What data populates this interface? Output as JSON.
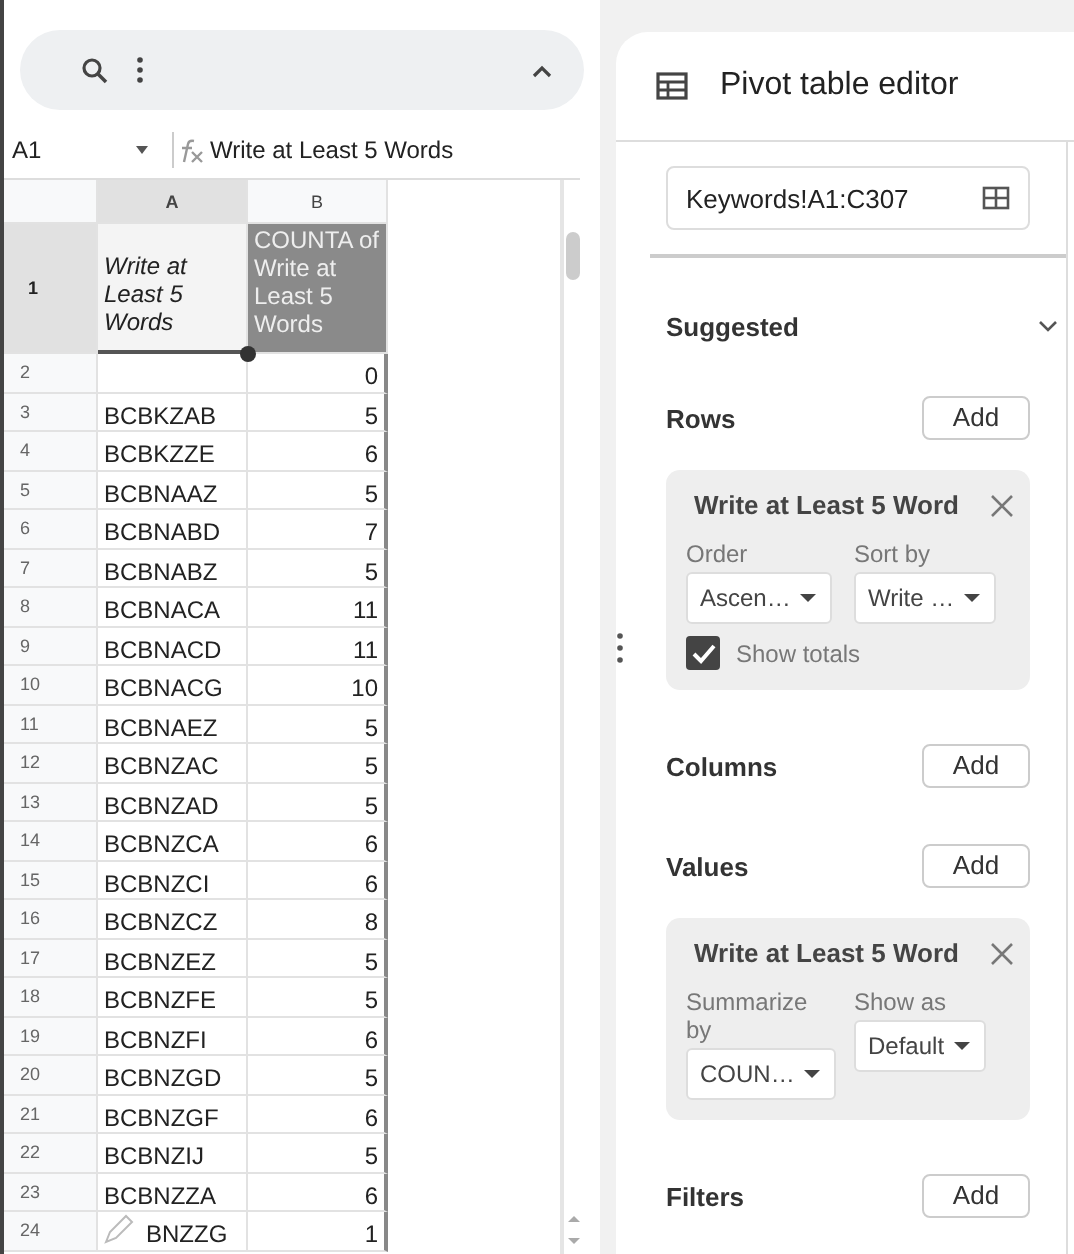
{
  "formula_bar": {
    "cell_ref": "A1",
    "formula": "Write at Least 5 Words"
  },
  "sheet": {
    "columns": [
      "A",
      "B"
    ],
    "header_row": {
      "number": "1",
      "label": "Write at Least 5 Words",
      "count_label": "COUNTA of Write at Least 5 Words"
    },
    "rows": [
      {
        "number": "2",
        "count": "0"
      },
      {
        "number": "3",
        "keyword": "BCBKZAB",
        "count": "5"
      },
      {
        "number": "4",
        "keyword": "BCBKZZE",
        "count": "6"
      },
      {
        "number": "5",
        "keyword": "BCBNAAZ",
        "count": "5"
      },
      {
        "number": "6",
        "keyword": "BCBNABD",
        "count": "7"
      },
      {
        "number": "7",
        "keyword": "BCBNABZ",
        "count": "5"
      },
      {
        "number": "8",
        "keyword": "BCBNACA",
        "count": "11"
      },
      {
        "number": "9",
        "keyword": "BCBNACD",
        "count": "11"
      },
      {
        "number": "10",
        "keyword": "BCBNACG",
        "count": "10"
      },
      {
        "number": "11",
        "keyword": "BCBNAEZ",
        "count": "5"
      },
      {
        "number": "12",
        "keyword": "BCBNZAC",
        "count": "5"
      },
      {
        "number": "13",
        "keyword": "BCBNZAD",
        "count": "5"
      },
      {
        "number": "14",
        "keyword": "BCBNZCA",
        "count": "6"
      },
      {
        "number": "15",
        "keyword": "BCBNZCI",
        "count": "6"
      },
      {
        "number": "16",
        "keyword": "BCBNZCZ",
        "count": "8"
      },
      {
        "number": "17",
        "keyword": "BCBNZEZ",
        "count": "5"
      },
      {
        "number": "18",
        "keyword": "BCBNZFE",
        "count": "5"
      },
      {
        "number": "19",
        "keyword": "BCBNZFI",
        "count": "6"
      },
      {
        "number": "20",
        "keyword": "BCBNZGD",
        "count": "5"
      },
      {
        "number": "21",
        "keyword": "BCBNZGF",
        "count": "6"
      },
      {
        "number": "22",
        "keyword": "BCBNZIJ",
        "count": "5"
      },
      {
        "number": "23",
        "keyword": "BCBNZZA",
        "count": "6"
      },
      {
        "number": "24",
        "keyword": "BNZZG",
        "count": "1",
        "edit_overlay": true
      }
    ]
  },
  "editor": {
    "title": "Pivot table editor",
    "range": "Keywords!A1:C307",
    "sections": [
      {
        "kind": "suggested",
        "label": "Suggested",
        "expanded": false
      },
      {
        "kind": "field",
        "label": "Rows",
        "button": "Add",
        "card": {
          "title": "Write at Least 5 Word",
          "fields": [
            {
              "label": "Order",
              "value": "Ascen…"
            },
            {
              "label": "Sort by",
              "value": "Write …"
            }
          ],
          "checkbox": {
            "label": "Show totals",
            "checked": true
          }
        }
      },
      {
        "kind": "field",
        "label": "Columns",
        "button": "Add"
      },
      {
        "kind": "field",
        "label": "Values",
        "button": "Add",
        "card": {
          "title": "Write at Least 5 Word",
          "fields": [
            {
              "label": "Summarize by",
              "value": "COUN…"
            },
            {
              "label": "Show as",
              "value": "Default"
            }
          ]
        }
      },
      {
        "kind": "field",
        "label": "Filters",
        "button": "Add"
      }
    ]
  }
}
